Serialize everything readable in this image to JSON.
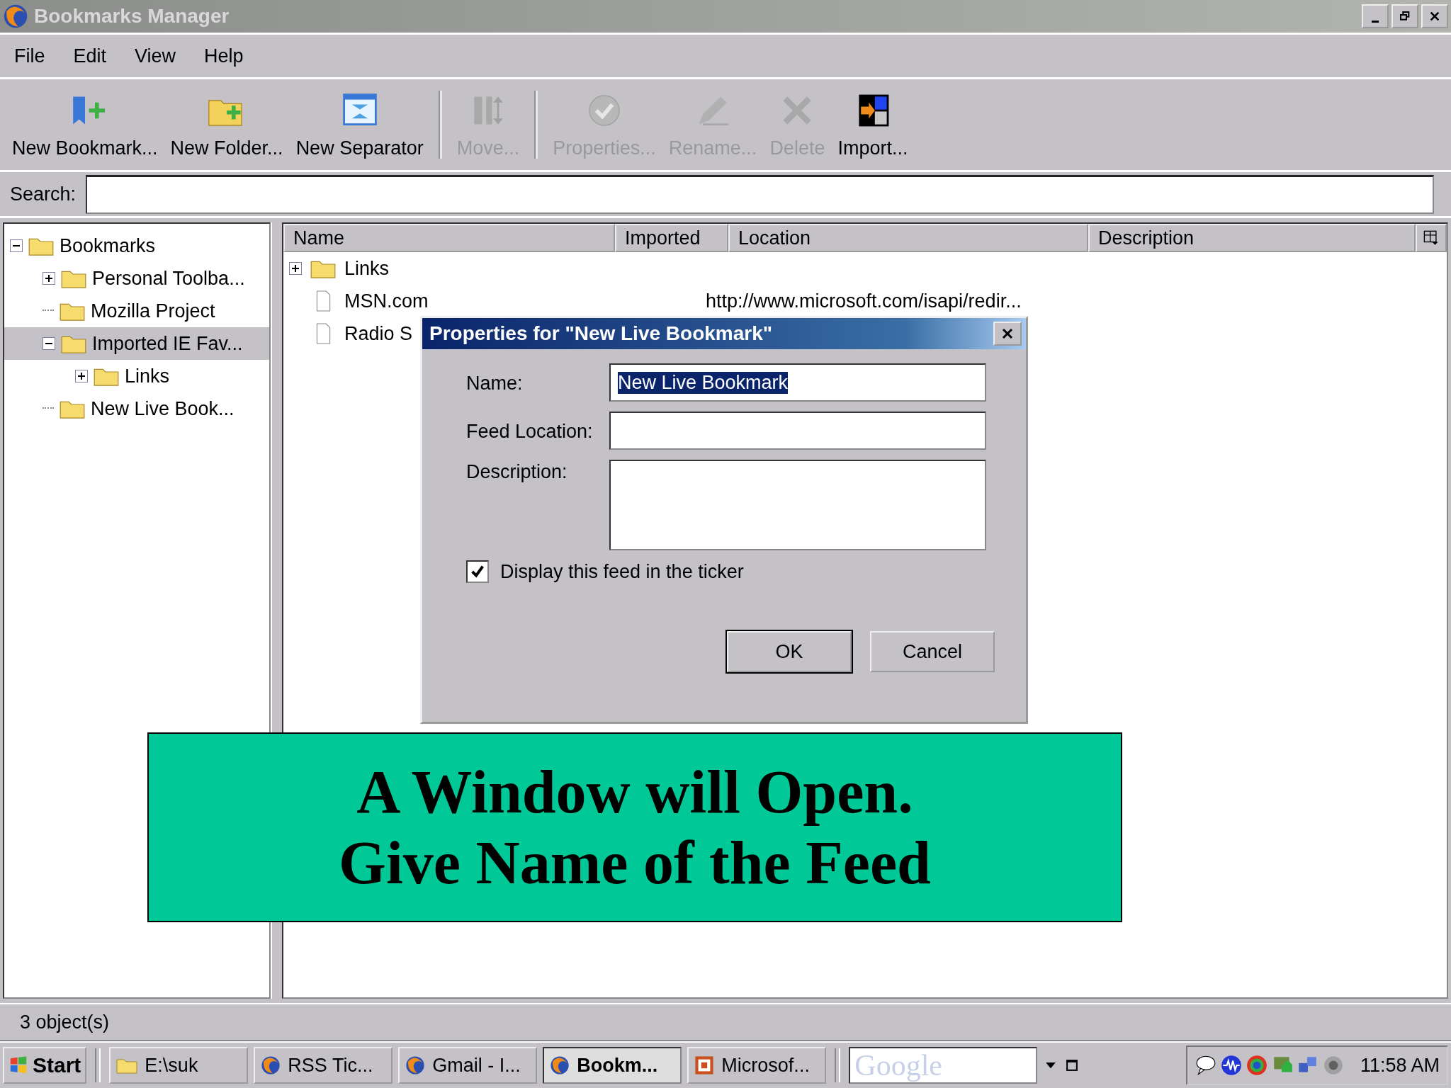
{
  "window": {
    "title": "Bookmarks Manager"
  },
  "menu": [
    "File",
    "Edit",
    "View",
    "Help"
  ],
  "toolbar": [
    {
      "kind": "button",
      "label": "New Bookmark...",
      "disabled": false
    },
    {
      "kind": "button",
      "label": "New Folder...",
      "disabled": false
    },
    {
      "kind": "button",
      "label": "New Separator",
      "disabled": false
    },
    {
      "kind": "separator"
    },
    {
      "kind": "button",
      "label": "Move...",
      "disabled": true
    },
    {
      "kind": "separator"
    },
    {
      "kind": "button",
      "label": "Properties...",
      "disabled": true
    },
    {
      "kind": "button",
      "label": "Rename...",
      "disabled": true
    },
    {
      "kind": "button",
      "label": "Delete",
      "disabled": true
    },
    {
      "kind": "button",
      "label": "Import...",
      "disabled": false
    }
  ],
  "search": {
    "label": "Search:"
  },
  "tree": [
    {
      "label": "Bookmarks",
      "expanded": true,
      "selected": false,
      "children": [
        {
          "label": "Personal Toolba...",
          "expanded": false,
          "selected": false
        },
        {
          "label": "Mozilla Project",
          "selected": false
        },
        {
          "label": "Imported IE Fav...",
          "expanded": true,
          "selected": true,
          "children": [
            {
              "label": "Links",
              "expanded": false,
              "selected": false
            }
          ]
        },
        {
          "label": "New Live Book...",
          "selected": false
        }
      ]
    }
  ],
  "table": {
    "columns": [
      "Name",
      "Imported",
      "Location",
      "Description"
    ],
    "rows": [
      {
        "kind": "folder",
        "name": "Links",
        "expanded": false
      },
      {
        "kind": "page",
        "name": "MSN.com",
        "location": "http://www.microsoft.com/isapi/redir..."
      },
      {
        "kind": "page",
        "name": "Radio S"
      }
    ]
  },
  "dialog": {
    "title": "Properties for \"New Live Bookmark\"",
    "fields": [
      {
        "kind": "line",
        "label": "Name:",
        "value": "New Live Bookmark",
        "selected": true
      },
      {
        "kind": "line",
        "label": "Feed Location:"
      },
      {
        "kind": "area",
        "label": "Description:"
      }
    ],
    "checkbox": {
      "label": "Display this feed in the ticker",
      "checked": true
    },
    "buttons": [
      {
        "label": "OK",
        "default": true
      },
      {
        "label": "Cancel",
        "default": false
      }
    ]
  },
  "callout": {
    "lines": [
      "A Window will Open.",
      "Give Name of the Feed"
    ]
  },
  "status_bar": "3 object(s)",
  "taskbar": {
    "start": "Start",
    "items": [
      {
        "label": "E:\\suk",
        "kind": "folder",
        "selected": false
      },
      {
        "label": "RSS Tic...",
        "kind": "browser",
        "selected": false
      },
      {
        "label": "Gmail - I...",
        "kind": "browser",
        "selected": false
      },
      {
        "label": "Bookm...",
        "kind": "browser",
        "selected": true
      },
      {
        "label": "Microsof...",
        "kind": "slides",
        "selected": false
      }
    ],
    "search_logo": "Google",
    "clock": "11:58 AM"
  }
}
